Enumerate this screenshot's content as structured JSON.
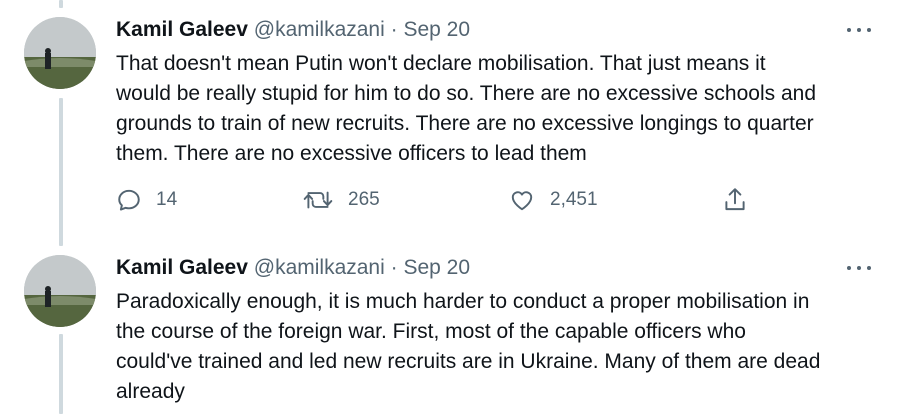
{
  "tweets": [
    {
      "name": "Kamil Galeev",
      "handle": "@kamilkazani",
      "separator": "·",
      "date": "Sep 20",
      "lines": [
        "That doesn't mean Putin won't declare mobilisation. That just means it",
        "would be really stupid for him to do so. There are no excessive schools and",
        "grounds to train  of new recruits. There are no excessive longings to quarter",
        "them. There are no excessive officers to lead them"
      ],
      "replies": "14",
      "retweets": "265",
      "likes": "2,451"
    },
    {
      "name": "Kamil Galeev",
      "handle": "@kamilkazani",
      "separator": "·",
      "date": "Sep 20",
      "lines": [
        "Paradoxically enough, it is much harder to conduct a proper mobilisation in",
        "the course of the foreign war. First, most of the capable officers who",
        "could've trained and led new recruits are in Ukraine. Many of them are dead",
        "already"
      ]
    }
  ],
  "icons": {
    "more": "more-horizontal-icon",
    "reply": "reply-icon",
    "retweet": "retweet-icon",
    "like": "heart-icon",
    "share": "share-icon"
  },
  "colors": {
    "text": "#0f1419",
    "secondary": "#536471",
    "thread_line": "#cfd9de"
  }
}
